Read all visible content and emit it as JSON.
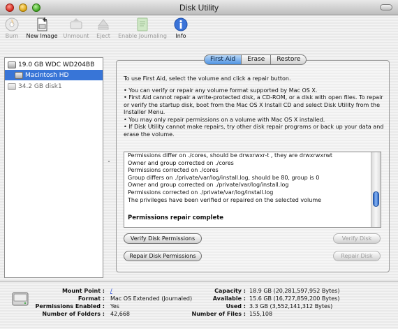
{
  "window": {
    "title": "Disk Utility"
  },
  "toolbar": {
    "items": [
      {
        "label": "Burn",
        "icon": "burn-icon",
        "enabled": false
      },
      {
        "label": "New Image",
        "icon": "new-image-icon",
        "enabled": true
      },
      {
        "label": "Unmount",
        "icon": "unmount-icon",
        "enabled": false
      },
      {
        "label": "Eject",
        "icon": "eject-icon",
        "enabled": false
      },
      {
        "label": "Enable Journaling",
        "icon": "journaling-icon",
        "enabled": false
      },
      {
        "label": "Info",
        "icon": "info-icon",
        "enabled": true
      }
    ]
  },
  "sidebar": {
    "disks": [
      {
        "label": "19.0 GB WDC WD204BB",
        "selected": false
      },
      {
        "label": "Macintosh HD",
        "selected": true
      },
      {
        "label": "34.2 GB disk1",
        "selected": false
      }
    ]
  },
  "tabs": [
    {
      "label": "First Aid",
      "active": true
    },
    {
      "label": "Erase",
      "active": false
    },
    {
      "label": "Restore",
      "active": false
    }
  ],
  "firstaid": {
    "intro": "To use First Aid, select the volume and click a repair button.",
    "bullets": [
      "• You can verify or repair any volume format supported by Mac OS X.",
      "• First Aid cannot repair a write-protected disk, a CD-ROM, or a disk with open files. To repair or verify the startup disk, boot from the Mac OS X Install CD and select Disk Utility from the Installer Menu.",
      "• You may only repair permissions on a volume with Mac OS X installed.",
      "• If Disk Utility cannot make repairs, try other disk repair programs or back up your data and erase the volume."
    ],
    "log_lines": [
      "Permissions differ on ./cores, should be drwxrwxr-t , they are drwxrwxrwt",
      "Owner and group corrected on ./cores",
      "Permissions corrected on ./cores",
      "Group differs on ./private/var/log/install.log, should be 80, group is 0",
      "Owner and group corrected on ./private/var/log/install.log",
      "Permissions corrected on ./private/var/log/install.log",
      "The privileges have been verified or repaired on the selected volume"
    ],
    "log_complete": "Permissions repair complete",
    "buttons": {
      "verify_permissions": "Verify Disk Permissions",
      "repair_permissions": "Repair Disk Permissions",
      "verify_disk": "Verify Disk",
      "repair_disk": "Repair Disk"
    }
  },
  "info": {
    "mount_point_label": "Mount Point :",
    "mount_point_value": "/",
    "format_label": "Format :",
    "format_value": "Mac OS Extended (Journaled)",
    "permissions_label": "Permissions Enabled :",
    "permissions_value": "Yes",
    "folders_label": "Number of Folders :",
    "folders_value": "42,668",
    "capacity_label": "Capacity :",
    "capacity_value": "18.9 GB (20,281,597,952 Bytes)",
    "available_label": "Available :",
    "available_value": "15.6 GB (16,727,859,200 Bytes)",
    "used_label": "Used :",
    "used_value": "3.3 GB (3,552,141,312 Bytes)",
    "files_label": "Number of Files :",
    "files_value": "155,108"
  },
  "colors": {
    "selection": "#3875d7",
    "tab_active": "#4d93e3",
    "link": "#1a3fd6"
  }
}
